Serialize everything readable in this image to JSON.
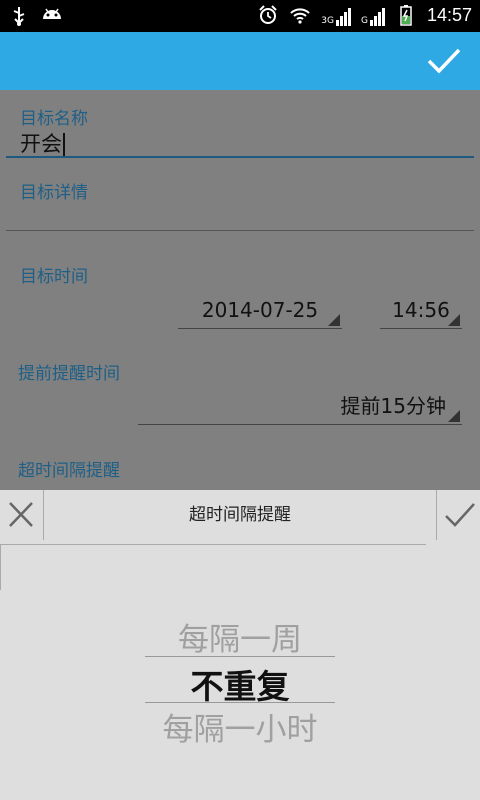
{
  "status_bar": {
    "left_icons": [
      "usb-icon",
      "android-icon"
    ],
    "right_icons": [
      "alarm-icon",
      "wifi-icon",
      "signal-3g-icon",
      "signal-g-icon",
      "battery-charging-icon"
    ],
    "network_3g": "3G",
    "network_g": "G",
    "time": "14:57"
  },
  "action_bar": {
    "confirm_icon": "checkmark-icon",
    "accent": "#2ea9e4"
  },
  "form": {
    "name_label": "目标名称",
    "name_value": "开会",
    "detail_label": "目标详情",
    "detail_value": "",
    "time_label": "目标时间",
    "date_value": "2014-07-25",
    "time_value": "14:56",
    "advance_label": "提前提醒时间",
    "advance_value": "提前15分钟",
    "overtime_label": "超时间隔提醒"
  },
  "picker_dialog": {
    "title": "超时间隔提醒",
    "cancel_icon": "close-icon",
    "confirm_icon": "checkmark-icon",
    "options_visible": [
      "每隔一周",
      "不重复",
      "每隔一小时"
    ],
    "selected": "不重复"
  }
}
